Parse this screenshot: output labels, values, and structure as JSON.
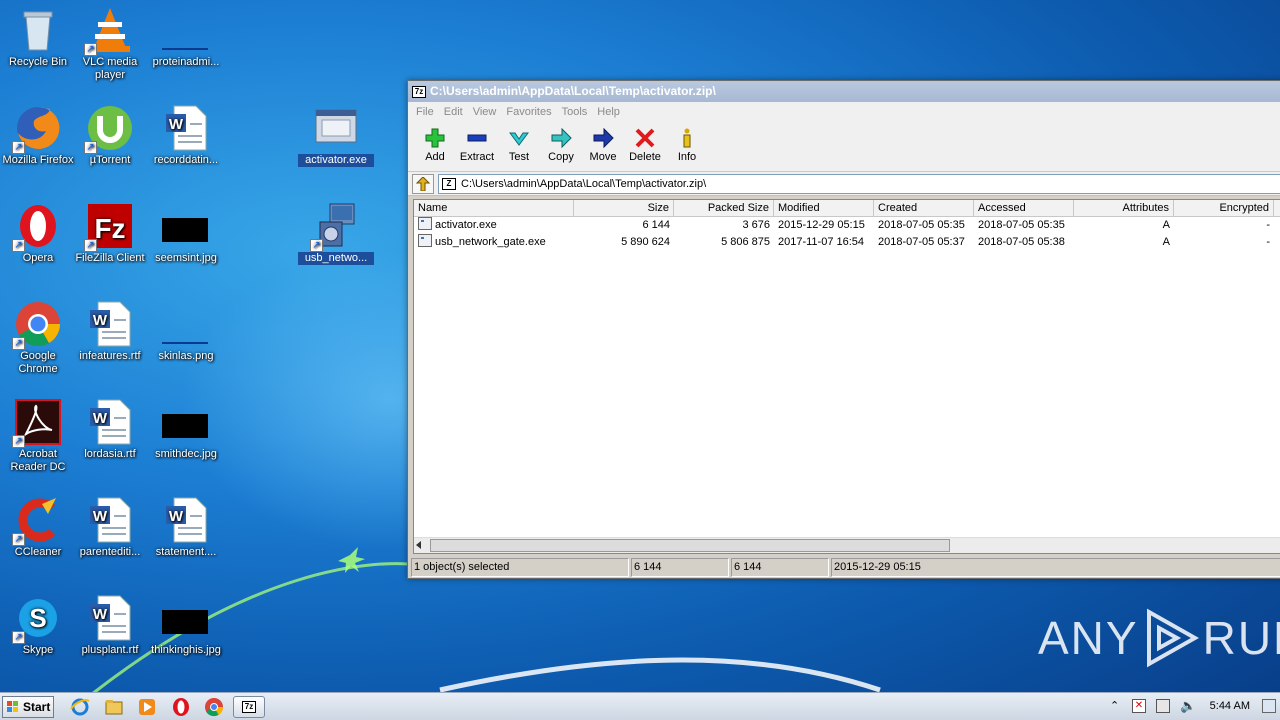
{
  "desktop": {
    "icons": [
      {
        "label": "Recycle Bin",
        "icon": "recycle-bin-icon"
      },
      {
        "label": "VLC media player",
        "icon": "vlc-icon"
      },
      {
        "label": "proteinadmi...",
        "icon": "image-file-icon"
      },
      {
        "label": "Mozilla Firefox",
        "icon": "firefox-icon"
      },
      {
        "label": "µTorrent",
        "icon": "utorrent-icon"
      },
      {
        "label": "recorddatin...",
        "icon": "word-doc-icon"
      },
      {
        "label": "activator.exe",
        "icon": "exe-file-icon"
      },
      {
        "label": "Opera",
        "icon": "opera-icon"
      },
      {
        "label": "FileZilla Client",
        "icon": "filezilla-icon"
      },
      {
        "label": "seemsint.jpg",
        "icon": "image-file-icon"
      },
      {
        "label": "usb_netwo...",
        "icon": "installer-icon"
      },
      {
        "label": "Google Chrome",
        "icon": "chrome-icon"
      },
      {
        "label": "infeatures.rtf",
        "icon": "word-doc-icon"
      },
      {
        "label": "skinlas.png",
        "icon": "image-file-icon"
      },
      {
        "label": "Acrobat Reader DC",
        "icon": "acrobat-icon"
      },
      {
        "label": "lordasia.rtf",
        "icon": "word-doc-icon"
      },
      {
        "label": "smithdec.jpg",
        "icon": "image-file-icon"
      },
      {
        "label": "CCleaner",
        "icon": "ccleaner-icon"
      },
      {
        "label": "parentediti...",
        "icon": "word-doc-icon"
      },
      {
        "label": "statement....",
        "icon": "word-doc-icon"
      },
      {
        "label": "Skype",
        "icon": "skype-icon"
      },
      {
        "label": "plusplant.rtf",
        "icon": "word-doc-icon"
      },
      {
        "label": "thinkinghis.jpg",
        "icon": "image-file-icon"
      }
    ]
  },
  "window": {
    "title": "C:\\Users\\admin\\AppData\\Local\\Temp\\activator.zip\\",
    "menu": [
      "File",
      "Edit",
      "View",
      "Favorites",
      "Tools",
      "Help"
    ],
    "toolbar": [
      "Add",
      "Extract",
      "Test",
      "Copy",
      "Move",
      "Delete",
      "Info"
    ],
    "address": "C:\\Users\\admin\\AppData\\Local\\Temp\\activator.zip\\",
    "columns": [
      "Name",
      "Size",
      "Packed Size",
      "Modified",
      "Created",
      "Accessed",
      "Attributes",
      "Encrypted"
    ],
    "rows": [
      {
        "name": "activator.exe",
        "size": "6 144",
        "packed": "3 676",
        "modified": "2015-12-29 05:15",
        "created": "2018-07-05 05:35",
        "accessed": "2018-07-05 05:35",
        "attributes": "A",
        "encrypted": "-"
      },
      {
        "name": "usb_network_gate.exe",
        "size": "5 890 624",
        "packed": "5 806 875",
        "modified": "2017-11-07 16:54",
        "created": "2018-07-05 05:37",
        "accessed": "2018-07-05 05:38",
        "attributes": "A",
        "encrypted": "-"
      }
    ],
    "status": {
      "selected": "1 object(s) selected",
      "size": "6 144",
      "packed": "6 144",
      "modified": "2015-12-29 05:15"
    }
  },
  "taskbar": {
    "start_label": "Start",
    "clock": "5:44 AM"
  },
  "watermark": {
    "left": "ANY",
    "right": "RUN"
  }
}
